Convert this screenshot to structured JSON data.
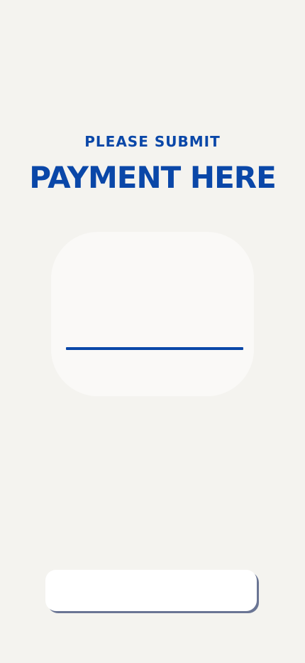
{
  "header": {
    "subtitle": "PLEASE SUBMIT",
    "title": "PAYMENT HERE"
  },
  "payment_card": {
    "input_value": ""
  },
  "submit_button": {
    "label": ""
  },
  "colors": {
    "background": "#f4f3ef",
    "accent": "#0a47a8",
    "card": "#faf9f7",
    "button_shadow": "#6a7594"
  }
}
